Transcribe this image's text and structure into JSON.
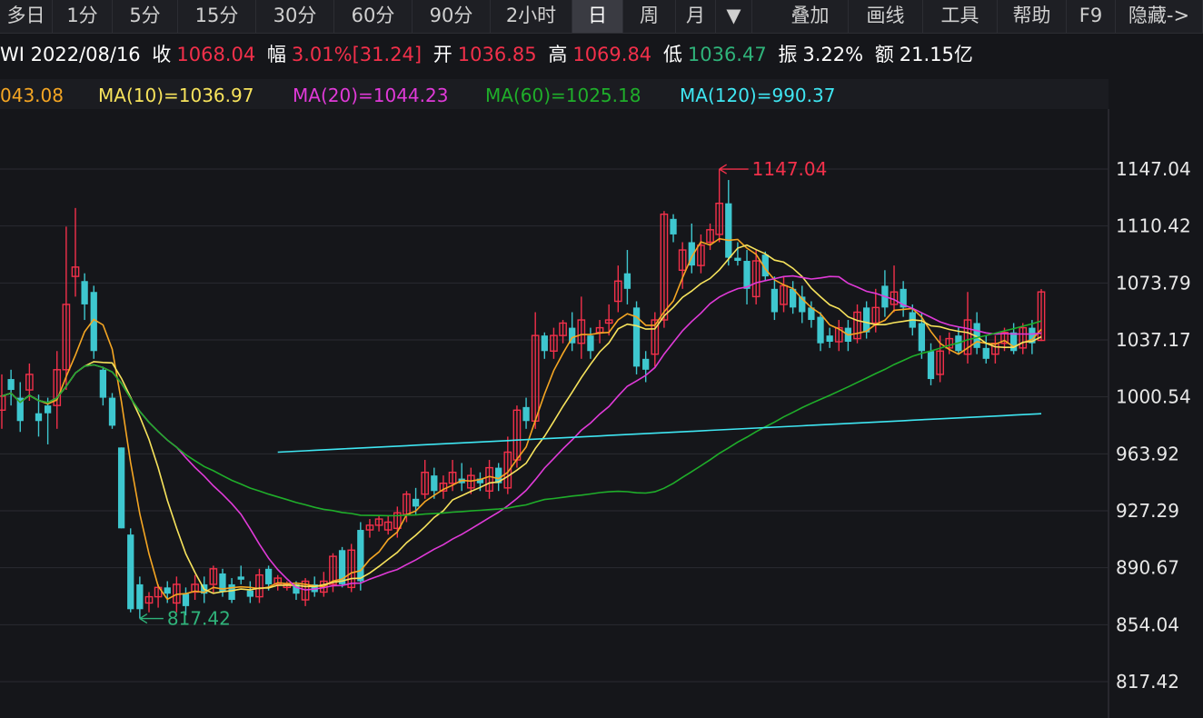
{
  "toolbar": {
    "items": [
      {
        "label": "多日",
        "active": false
      },
      {
        "label": "1分",
        "active": false
      },
      {
        "label": "5分",
        "active": false
      },
      {
        "label": "15分",
        "active": false
      },
      {
        "label": "30分",
        "active": false
      },
      {
        "label": "60分",
        "active": false
      },
      {
        "label": "90分",
        "active": false
      },
      {
        "label": "2小时",
        "active": false
      },
      {
        "label": "日",
        "active": true
      },
      {
        "label": "周",
        "active": false
      },
      {
        "label": "月",
        "active": false
      }
    ],
    "right_items": [
      "叠加",
      "画线",
      "工具",
      "帮助",
      "F9",
      "隐藏->"
    ]
  },
  "quote": {
    "code_date": "WI 2022/08/16",
    "close_label": "收",
    "close": "1068.04",
    "change_label": "幅",
    "change": "3.01%[31.24]",
    "open_label": "开",
    "open": "1036.85",
    "high_label": "高",
    "high": "1069.84",
    "low_label": "低",
    "low": "1036.47",
    "amp_label": "振",
    "amp": "3.22%",
    "amount_label": "额",
    "amount": "21.15亿"
  },
  "ma_labels": [
    {
      "text": "043.08",
      "color": "#f5a623"
    },
    {
      "text": "MA(10)=1036.97",
      "color": "#f7e35c"
    },
    {
      "text": "MA(20)=1044.23",
      "color": "#e03ad8"
    },
    {
      "text": "MA(60)=1025.18",
      "color": "#1fae2a"
    },
    {
      "text": "MA(120)=990.37",
      "color": "#3fe6f2"
    }
  ],
  "colors": {
    "up": "#f2304a",
    "down": "#3ec7cf",
    "grid": "#2a2b31",
    "axis_text": "#e8e8e8",
    "ma5": "#f5a623",
    "ma10": "#f7e35c",
    "ma20": "#e03ad8",
    "ma60": "#1fae2a",
    "ma120": "#3fe6f2",
    "high_marker": "#f2304a",
    "low_marker": "#2fb37a"
  },
  "chart_data": {
    "type": "candlestick",
    "y_ticks": [
      1147.04,
      1110.42,
      1073.79,
      1037.17,
      1000.54,
      963.92,
      927.29,
      890.67,
      854.04,
      817.42
    ],
    "ylim": [
      817.42,
      1147.04
    ],
    "high_marker": "1147.04",
    "low_marker": "817.42",
    "candles": [
      [
        992,
        1001,
        980,
        1015
      ],
      [
        1012,
        1005,
        995,
        1018
      ],
      [
        1000,
        985,
        978,
        1010
      ],
      [
        1005,
        1015,
        998,
        1022
      ],
      [
        990,
        985,
        975,
        1002
      ],
      [
        995,
        990,
        970,
        1000
      ],
      [
        995,
        1018,
        980,
        1030
      ],
      [
        1018,
        1060,
        1005,
        1110
      ],
      [
        1078,
        1084,
        1065,
        1122
      ],
      [
        1075,
        1060,
        1050,
        1080
      ],
      [
        1068,
        1030,
        1025,
        1072
      ],
      [
        1018,
        1000,
        995,
        1020
      ],
      [
        1000,
        982,
        980,
        1003
      ],
      [
        968,
        916,
        916,
        968
      ],
      [
        912,
        864,
        862,
        916
      ],
      [
        880,
        864,
        858,
        885
      ],
      [
        868,
        872,
        862,
        875
      ],
      [
        872,
        878,
        865,
        880
      ],
      [
        878,
        874,
        868,
        882
      ],
      [
        868,
        880,
        862,
        885
      ],
      [
        874,
        866,
        860,
        878
      ],
      [
        875,
        880,
        870,
        886
      ],
      [
        880,
        874,
        868,
        885
      ],
      [
        880,
        890,
        874,
        892
      ],
      [
        887,
        875,
        872,
        890
      ],
      [
        880,
        870,
        868,
        884
      ],
      [
        885,
        883,
        880,
        892
      ],
      [
        876,
        872,
        868,
        882
      ],
      [
        872,
        886,
        868,
        890
      ],
      [
        890,
        880,
        876,
        892
      ],
      [
        880,
        884,
        876,
        886
      ],
      [
        878,
        880,
        876,
        882
      ],
      [
        880,
        874,
        870,
        882
      ],
      [
        870,
        882,
        866,
        884
      ],
      [
        880,
        875,
        872,
        885
      ],
      [
        875,
        882,
        872,
        888
      ],
      [
        880,
        898,
        875,
        900
      ],
      [
        902,
        880,
        878,
        904
      ],
      [
        878,
        902,
        875,
        906
      ],
      [
        915,
        882,
        876,
        920
      ],
      [
        915,
        918,
        910,
        922
      ],
      [
        918,
        922,
        914,
        924
      ],
      [
        915,
        920,
        912,
        924
      ],
      [
        916,
        926,
        910,
        930
      ],
      [
        925,
        938,
        920,
        940
      ],
      [
        935,
        930,
        925,
        942
      ],
      [
        938,
        952,
        935,
        960
      ],
      [
        950,
        940,
        935,
        955
      ],
      [
        940,
        945,
        935,
        950
      ],
      [
        945,
        952,
        940,
        960
      ],
      [
        948,
        945,
        940,
        958
      ],
      [
        942,
        950,
        938,
        955
      ],
      [
        948,
        945,
        940,
        952
      ],
      [
        940,
        955,
        935,
        960
      ],
      [
        955,
        945,
        940,
        958
      ],
      [
        942,
        965,
        938,
        975
      ],
      [
        960,
        992,
        955,
        995
      ],
      [
        994,
        985,
        980,
        1000
      ],
      [
        985,
        1040,
        980,
        1055
      ],
      [
        1040,
        1030,
        1025,
        1042
      ],
      [
        1030,
        1040,
        1025,
        1045
      ],
      [
        1040,
        1048,
        1035,
        1050
      ],
      [
        1045,
        1035,
        1030,
        1055
      ],
      [
        1035,
        1050,
        1025,
        1065
      ],
      [
        1040,
        1030,
        1025,
        1045
      ],
      [
        1042,
        1045,
        1035,
        1050
      ],
      [
        1048,
        1050,
        1040,
        1060
      ],
      [
        1062,
        1075,
        1055,
        1085
      ],
      [
        1080,
        1070,
        1060,
        1095
      ],
      [
        1058,
        1020,
        1015,
        1062
      ],
      [
        1025,
        1018,
        1010,
        1030
      ],
      [
        1028,
        1050,
        1020,
        1055
      ],
      [
        1050,
        1118,
        1045,
        1120
      ],
      [
        1115,
        1105,
        1100,
        1118
      ],
      [
        1082,
        1095,
        1070,
        1100
      ],
      [
        1100,
        1085,
        1080,
        1112
      ],
      [
        1085,
        1098,
        1080,
        1105
      ],
      [
        1100,
        1108,
        1095,
        1112
      ],
      [
        1105,
        1125,
        1100,
        1147
      ],
      [
        1125,
        1090,
        1085,
        1140
      ],
      [
        1090,
        1088,
        1085,
        1100
      ],
      [
        1088,
        1070,
        1060,
        1095
      ],
      [
        1065,
        1088,
        1060,
        1095
      ],
      [
        1092,
        1078,
        1075,
        1094
      ],
      [
        1070,
        1055,
        1050,
        1078
      ],
      [
        1060,
        1072,
        1055,
        1078
      ],
      [
        1070,
        1058,
        1054,
        1075
      ],
      [
        1065,
        1055,
        1048,
        1072
      ],
      [
        1058,
        1050,
        1045,
        1062
      ],
      [
        1052,
        1035,
        1030,
        1055
      ],
      [
        1040,
        1036,
        1032,
        1045
      ],
      [
        1036,
        1045,
        1030,
        1050
      ],
      [
        1045,
        1036,
        1030,
        1050
      ],
      [
        1038,
        1055,
        1035,
        1060
      ],
      [
        1058,
        1042,
        1038,
        1062
      ],
      [
        1048,
        1058,
        1042,
        1070
      ],
      [
        1072,
        1058,
        1052,
        1082
      ],
      [
        1060,
        1068,
        1055,
        1085
      ],
      [
        1070,
        1058,
        1052,
        1075
      ],
      [
        1055,
        1045,
        1040,
        1060
      ],
      [
        1048,
        1030,
        1025,
        1055
      ],
      [
        1030,
        1012,
        1008,
        1035
      ],
      [
        1015,
        1030,
        1010,
        1040
      ],
      [
        1032,
        1038,
        1028,
        1042
      ],
      [
        1040,
        1030,
        1028,
        1045
      ],
      [
        1028,
        1050,
        1022,
        1068
      ],
      [
        1048,
        1032,
        1028,
        1055
      ],
      [
        1032,
        1025,
        1022,
        1040
      ],
      [
        1028,
        1035,
        1022,
        1040
      ],
      [
        1035,
        1042,
        1030,
        1045
      ],
      [
        1042,
        1030,
        1028,
        1048
      ],
      [
        1032,
        1045,
        1028,
        1048
      ],
      [
        1045,
        1035,
        1028,
        1050
      ],
      [
        1036.85,
        1068.04,
        1036.47,
        1069.84
      ]
    ]
  }
}
